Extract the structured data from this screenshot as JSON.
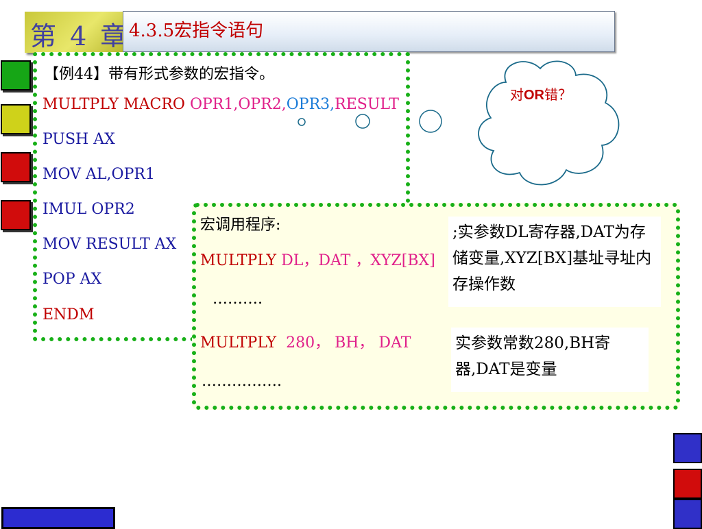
{
  "header": {
    "chapter_label": "第 4 章",
    "title": "4.3.5宏指令语句"
  },
  "code_box": {
    "example_label": "【例44】带有形式参数的宏指令。",
    "macro_name": "MULTPLY MACRO",
    "param1": "OPR1,",
    "param2": "OPR2,",
    "param3": "OPR3,",
    "param4": "RESULT",
    "lines": [
      "PUSH AX",
      "MOV AL,OPR1",
      "IMUL OPR2",
      "MOV RESULT AX",
      "POP AX"
    ],
    "end": "ENDM"
  },
  "call_box": {
    "label": "宏调用程序:",
    "call1_name": "MULTPLY",
    "call1_args": "DL，DAT ，XYZ[BX]",
    "ellipsis1": "……….",
    "call2_name": "MULTPLY",
    "call2_args": "280， BH， DAT",
    "ellipsis2": "…………….",
    "note1": ";实参数DL寄存器,DAT为存储变量,XYZ[BX]基址寻址内存操作数",
    "note2": "实参数常数280,BH寄器,DAT是变量"
  },
  "cloud": {
    "prefix": "对",
    "keyword": "OR",
    "suffix": "错？"
  },
  "colors": {
    "dots": "#18b018",
    "title_red": "#c00000",
    "code_blue": "#1a1aa0",
    "param_magenta": "#e0208a",
    "param_cyan": "#1c7cd8"
  }
}
